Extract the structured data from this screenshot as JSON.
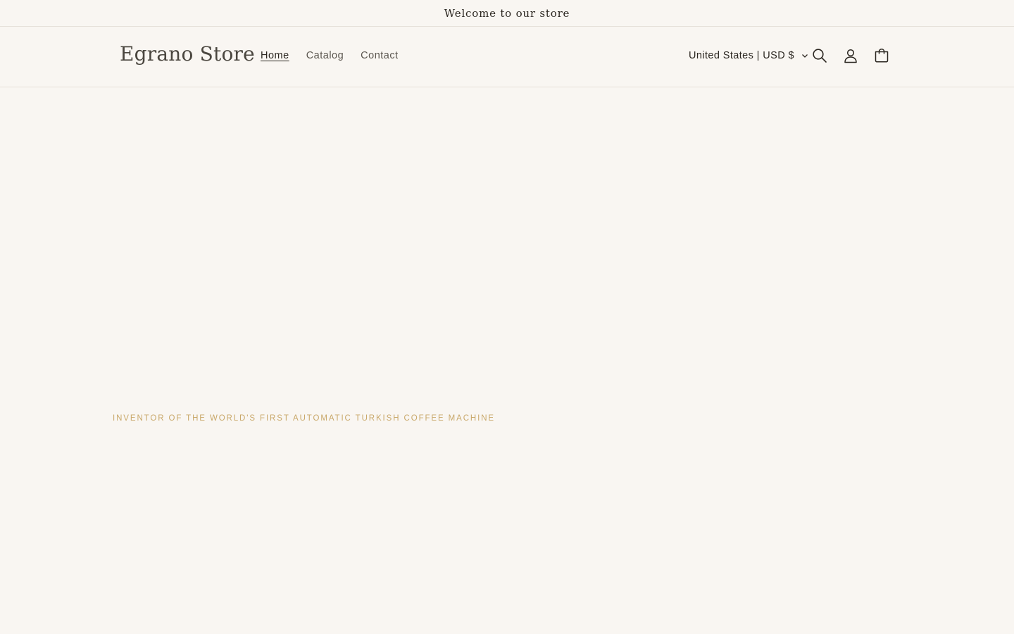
{
  "announcement": {
    "text": "Welcome to our store"
  },
  "header": {
    "logo": "Egrano Store",
    "nav": [
      {
        "label": "Home",
        "active": true
      },
      {
        "label": "Catalog",
        "active": false
      },
      {
        "label": "Contact",
        "active": false
      }
    ],
    "country_selector": {
      "label": "United States | USD $",
      "icon": "chevron-down-icon"
    },
    "icons": [
      "search-icon",
      "account-icon",
      "cart-icon"
    ]
  },
  "hero": {
    "tagline": "INVENTOR OF THE WORLD'S FIRST AUTOMATIC TURKISH COFFEE MACHINE"
  },
  "colors": {
    "background": "#f9f6f2",
    "text": "#2b2620",
    "muted": "#5b564f",
    "accent": "#c9a86a",
    "border": "#e6e1da"
  }
}
